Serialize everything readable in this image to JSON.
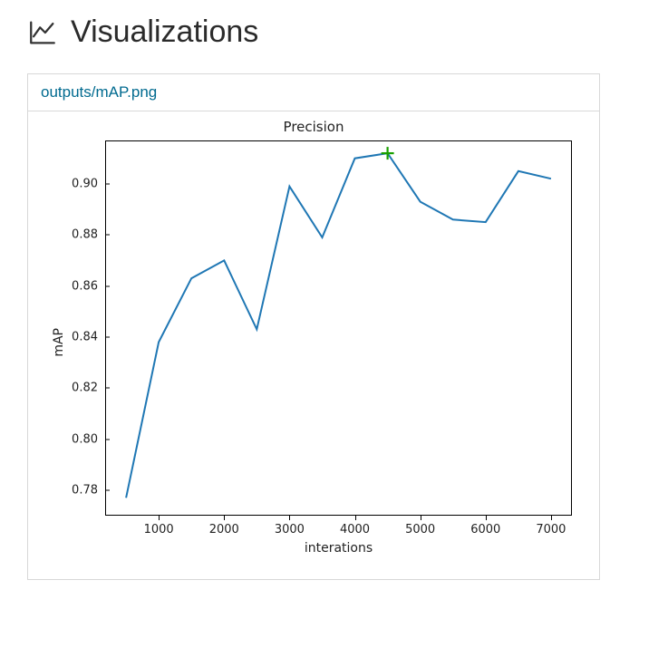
{
  "header": {
    "title": "Visualizations",
    "icon_name": "line-chart-icon"
  },
  "card": {
    "file_name": "outputs/mAP.png"
  },
  "chart_data": {
    "type": "line",
    "title": "Precision",
    "xlabel": "interations",
    "ylabel": "mAP",
    "xlim": [
      180,
      7320
    ],
    "ylim": [
      0.77,
      0.917
    ],
    "x_ticks": [
      1000,
      2000,
      3000,
      4000,
      5000,
      6000,
      7000
    ],
    "y_ticks": [
      0.78,
      0.8,
      0.82,
      0.84,
      0.86,
      0.88,
      0.9
    ],
    "x": [
      500,
      1000,
      1500,
      2000,
      2500,
      3000,
      3500,
      4000,
      4500,
      5000,
      5500,
      6000,
      6500,
      7000
    ],
    "values": [
      0.777,
      0.838,
      0.863,
      0.87,
      0.843,
      0.899,
      0.879,
      0.91,
      0.912,
      0.893,
      0.886,
      0.885,
      0.905,
      0.902
    ],
    "marker": {
      "x": 4500,
      "y": 0.912,
      "symbol": "plus",
      "color": "#1aa000"
    },
    "line_color": "#1f77b4"
  }
}
